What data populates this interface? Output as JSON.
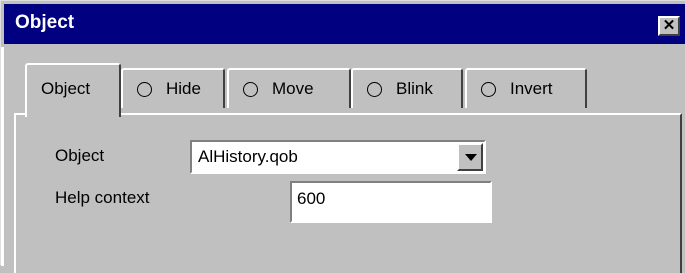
{
  "window": {
    "title": "Object",
    "close_glyph": "✕"
  },
  "tabs": [
    {
      "label": "Object",
      "active": true,
      "has_radio": false
    },
    {
      "label": "Hide",
      "active": false,
      "has_radio": true
    },
    {
      "label": "Move",
      "active": false,
      "has_radio": true
    },
    {
      "label": "Blink",
      "active": false,
      "has_radio": true
    },
    {
      "label": "Invert",
      "active": false,
      "has_radio": true
    }
  ],
  "form": {
    "object_label": "Object",
    "object_value": "AlHistory.qob",
    "help_context_label": "Help context",
    "help_context_value": "600"
  },
  "colors": {
    "titlebar": "#000080",
    "face": "#c0c0c0"
  },
  "icons": {
    "close": "close-icon",
    "dropdown": "chevron-down-icon",
    "radio": "radio-empty-icon"
  }
}
